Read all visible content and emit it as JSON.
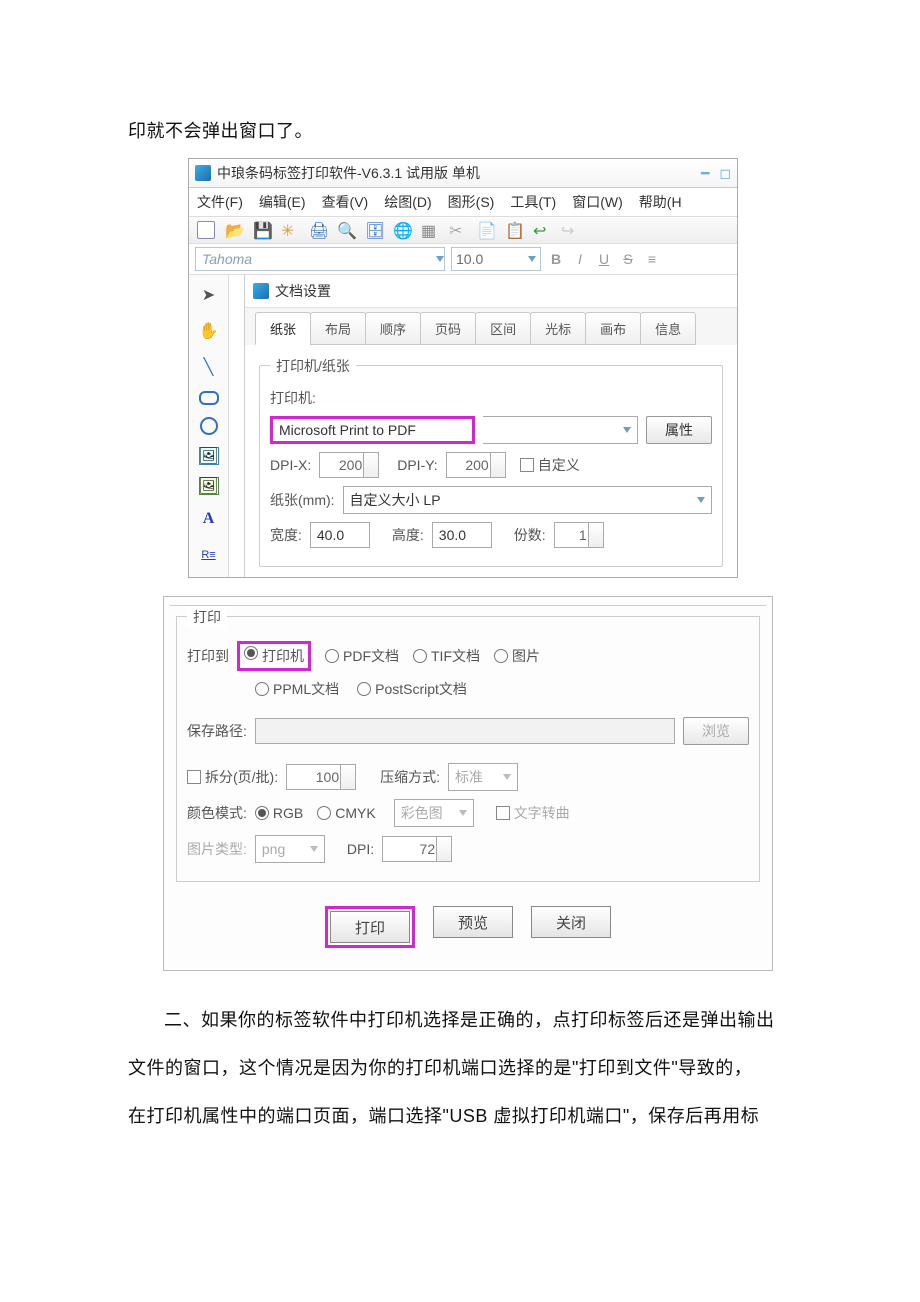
{
  "body_line1": "印就不会弹出窗口了。",
  "body_line2": "二、如果你的标签软件中打印机选择是正确的，点打印标签后还是弹出输出",
  "body_line3": "文件的窗口，这个情况是因为你的打印机端口选择的是\"打印到文件\"导致的，",
  "body_line4": "在打印机属性中的端口页面，端口选择\"USB 虚拟打印机端口\"，保存后再用标",
  "app_title": "中琅条码标签打印软件-V6.3.1 试用版 单机",
  "menus": {
    "file": "文件(F)",
    "edit": "编辑(E)",
    "view": "查看(V)",
    "draw": "绘图(D)",
    "shape": "图形(S)",
    "tool": "工具(T)",
    "window": "窗口(W)",
    "help": "帮助(H"
  },
  "font_name": "Tahoma",
  "font_size": "10.0",
  "fmt": {
    "b": "B",
    "i": "I",
    "u": "U",
    "s": "S"
  },
  "doc_settings_title": "文档设置",
  "tabs": {
    "paper": "纸张",
    "layout": "布局",
    "order": "顺序",
    "page": "页码",
    "range": "区间",
    "cursor": "光标",
    "canvas": "画布",
    "info": "信息"
  },
  "group_printer_paper": "打印机/纸张",
  "lbl_printer": "打印机:",
  "printer_value": "Microsoft Print to PDF",
  "btn_props": "属性",
  "lbl_dpix": "DPI-X:",
  "dpix_val": "200",
  "lbl_dpiy": "DPI-Y:",
  "dpiy_val": "200",
  "chk_custom": "自定义",
  "lbl_paper_mm": "纸张(mm):",
  "paper_val": "自定义大小 LP",
  "lbl_width": "宽度:",
  "width_val": "40.0",
  "lbl_height": "高度:",
  "height_val": "30.0",
  "lbl_copies": "份数:",
  "copies_val": "1",
  "group_print": "打印",
  "lbl_print_to": "打印到",
  "radio_printer": "打印机",
  "radio_pdf": "PDF文档",
  "radio_tif": "TIF文档",
  "radio_img": "图片",
  "radio_ppml": "PPML文档",
  "radio_ps": "PostScript文档",
  "lbl_save_path": "保存路径:",
  "btn_browse": "浏览",
  "chk_split": "拆分(页/批):",
  "split_val": "100",
  "lbl_compress": "压缩方式:",
  "compress_val": "标准",
  "lbl_colormode": "颜色模式:",
  "radio_rgb": "RGB",
  "radio_cmyk": "CMYK",
  "color_combo": "彩色图",
  "chk_text_curve": "文字转曲",
  "lbl_img_type": "图片类型:",
  "img_type_val": "png",
  "lbl_dpi": "DPI:",
  "dpi_val": "72",
  "btn_print": "打印",
  "btn_preview": "预览",
  "btn_close": "关闭"
}
